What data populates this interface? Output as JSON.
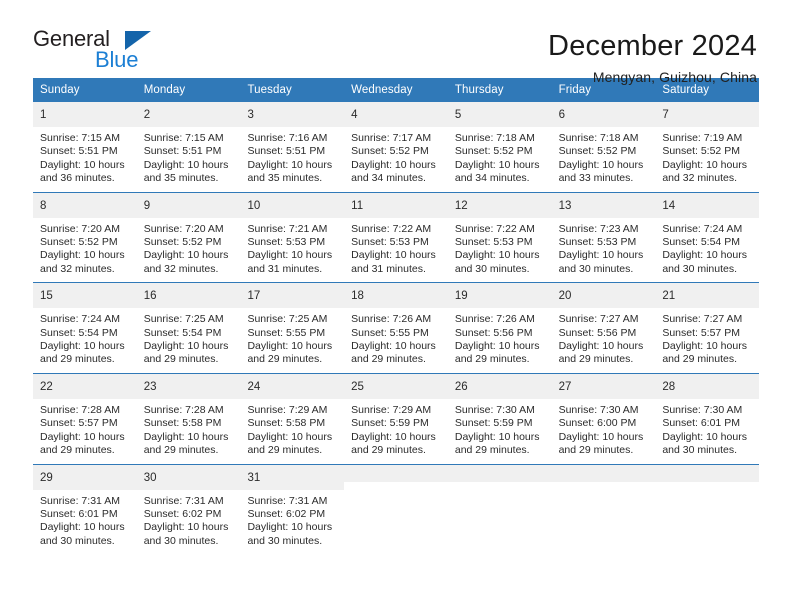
{
  "brand": {
    "name_part1": "General",
    "name_part2": "Blue",
    "triangle_icon": "triangle-icon",
    "color_dark": "#231f20",
    "color_blue": "#1c7fd4"
  },
  "header": {
    "title": "December 2024",
    "subtitle": "Mengyan, Guizhou, China"
  },
  "theme": {
    "header_bg": "#3079b8",
    "daynum_bg": "#f0f0f0",
    "text": "#2b2b2b"
  },
  "calendar": {
    "day_names": [
      "Sunday",
      "Monday",
      "Tuesday",
      "Wednesday",
      "Thursday",
      "Friday",
      "Saturday"
    ],
    "weeks": [
      [
        {
          "day": "1",
          "sunrise": "Sunrise: 7:15 AM",
          "sunset": "Sunset: 5:51 PM",
          "daylight1": "Daylight: 10 hours",
          "daylight2": "and 36 minutes."
        },
        {
          "day": "2",
          "sunrise": "Sunrise: 7:15 AM",
          "sunset": "Sunset: 5:51 PM",
          "daylight1": "Daylight: 10 hours",
          "daylight2": "and 35 minutes."
        },
        {
          "day": "3",
          "sunrise": "Sunrise: 7:16 AM",
          "sunset": "Sunset: 5:51 PM",
          "daylight1": "Daylight: 10 hours",
          "daylight2": "and 35 minutes."
        },
        {
          "day": "4",
          "sunrise": "Sunrise: 7:17 AM",
          "sunset": "Sunset: 5:52 PM",
          "daylight1": "Daylight: 10 hours",
          "daylight2": "and 34 minutes."
        },
        {
          "day": "5",
          "sunrise": "Sunrise: 7:18 AM",
          "sunset": "Sunset: 5:52 PM",
          "daylight1": "Daylight: 10 hours",
          "daylight2": "and 34 minutes."
        },
        {
          "day": "6",
          "sunrise": "Sunrise: 7:18 AM",
          "sunset": "Sunset: 5:52 PM",
          "daylight1": "Daylight: 10 hours",
          "daylight2": "and 33 minutes."
        },
        {
          "day": "7",
          "sunrise": "Sunrise: 7:19 AM",
          "sunset": "Sunset: 5:52 PM",
          "daylight1": "Daylight: 10 hours",
          "daylight2": "and 32 minutes."
        }
      ],
      [
        {
          "day": "8",
          "sunrise": "Sunrise: 7:20 AM",
          "sunset": "Sunset: 5:52 PM",
          "daylight1": "Daylight: 10 hours",
          "daylight2": "and 32 minutes."
        },
        {
          "day": "9",
          "sunrise": "Sunrise: 7:20 AM",
          "sunset": "Sunset: 5:52 PM",
          "daylight1": "Daylight: 10 hours",
          "daylight2": "and 32 minutes."
        },
        {
          "day": "10",
          "sunrise": "Sunrise: 7:21 AM",
          "sunset": "Sunset: 5:53 PM",
          "daylight1": "Daylight: 10 hours",
          "daylight2": "and 31 minutes."
        },
        {
          "day": "11",
          "sunrise": "Sunrise: 7:22 AM",
          "sunset": "Sunset: 5:53 PM",
          "daylight1": "Daylight: 10 hours",
          "daylight2": "and 31 minutes."
        },
        {
          "day": "12",
          "sunrise": "Sunrise: 7:22 AM",
          "sunset": "Sunset: 5:53 PM",
          "daylight1": "Daylight: 10 hours",
          "daylight2": "and 30 minutes."
        },
        {
          "day": "13",
          "sunrise": "Sunrise: 7:23 AM",
          "sunset": "Sunset: 5:53 PM",
          "daylight1": "Daylight: 10 hours",
          "daylight2": "and 30 minutes."
        },
        {
          "day": "14",
          "sunrise": "Sunrise: 7:24 AM",
          "sunset": "Sunset: 5:54 PM",
          "daylight1": "Daylight: 10 hours",
          "daylight2": "and 30 minutes."
        }
      ],
      [
        {
          "day": "15",
          "sunrise": "Sunrise: 7:24 AM",
          "sunset": "Sunset: 5:54 PM",
          "daylight1": "Daylight: 10 hours",
          "daylight2": "and 29 minutes."
        },
        {
          "day": "16",
          "sunrise": "Sunrise: 7:25 AM",
          "sunset": "Sunset: 5:54 PM",
          "daylight1": "Daylight: 10 hours",
          "daylight2": "and 29 minutes."
        },
        {
          "day": "17",
          "sunrise": "Sunrise: 7:25 AM",
          "sunset": "Sunset: 5:55 PM",
          "daylight1": "Daylight: 10 hours",
          "daylight2": "and 29 minutes."
        },
        {
          "day": "18",
          "sunrise": "Sunrise: 7:26 AM",
          "sunset": "Sunset: 5:55 PM",
          "daylight1": "Daylight: 10 hours",
          "daylight2": "and 29 minutes."
        },
        {
          "day": "19",
          "sunrise": "Sunrise: 7:26 AM",
          "sunset": "Sunset: 5:56 PM",
          "daylight1": "Daylight: 10 hours",
          "daylight2": "and 29 minutes."
        },
        {
          "day": "20",
          "sunrise": "Sunrise: 7:27 AM",
          "sunset": "Sunset: 5:56 PM",
          "daylight1": "Daylight: 10 hours",
          "daylight2": "and 29 minutes."
        },
        {
          "day": "21",
          "sunrise": "Sunrise: 7:27 AM",
          "sunset": "Sunset: 5:57 PM",
          "daylight1": "Daylight: 10 hours",
          "daylight2": "and 29 minutes."
        }
      ],
      [
        {
          "day": "22",
          "sunrise": "Sunrise: 7:28 AM",
          "sunset": "Sunset: 5:57 PM",
          "daylight1": "Daylight: 10 hours",
          "daylight2": "and 29 minutes."
        },
        {
          "day": "23",
          "sunrise": "Sunrise: 7:28 AM",
          "sunset": "Sunset: 5:58 PM",
          "daylight1": "Daylight: 10 hours",
          "daylight2": "and 29 minutes."
        },
        {
          "day": "24",
          "sunrise": "Sunrise: 7:29 AM",
          "sunset": "Sunset: 5:58 PM",
          "daylight1": "Daylight: 10 hours",
          "daylight2": "and 29 minutes."
        },
        {
          "day": "25",
          "sunrise": "Sunrise: 7:29 AM",
          "sunset": "Sunset: 5:59 PM",
          "daylight1": "Daylight: 10 hours",
          "daylight2": "and 29 minutes."
        },
        {
          "day": "26",
          "sunrise": "Sunrise: 7:30 AM",
          "sunset": "Sunset: 5:59 PM",
          "daylight1": "Daylight: 10 hours",
          "daylight2": "and 29 minutes."
        },
        {
          "day": "27",
          "sunrise": "Sunrise: 7:30 AM",
          "sunset": "Sunset: 6:00 PM",
          "daylight1": "Daylight: 10 hours",
          "daylight2": "and 29 minutes."
        },
        {
          "day": "28",
          "sunrise": "Sunrise: 7:30 AM",
          "sunset": "Sunset: 6:01 PM",
          "daylight1": "Daylight: 10 hours",
          "daylight2": "and 30 minutes."
        }
      ],
      [
        {
          "day": "29",
          "sunrise": "Sunrise: 7:31 AM",
          "sunset": "Sunset: 6:01 PM",
          "daylight1": "Daylight: 10 hours",
          "daylight2": "and 30 minutes."
        },
        {
          "day": "30",
          "sunrise": "Sunrise: 7:31 AM",
          "sunset": "Sunset: 6:02 PM",
          "daylight1": "Daylight: 10 hours",
          "daylight2": "and 30 minutes."
        },
        {
          "day": "31",
          "sunrise": "Sunrise: 7:31 AM",
          "sunset": "Sunset: 6:02 PM",
          "daylight1": "Daylight: 10 hours",
          "daylight2": "and 30 minutes."
        },
        {
          "day": "",
          "sunrise": "",
          "sunset": "",
          "daylight1": "",
          "daylight2": ""
        },
        {
          "day": "",
          "sunrise": "",
          "sunset": "",
          "daylight1": "",
          "daylight2": ""
        },
        {
          "day": "",
          "sunrise": "",
          "sunset": "",
          "daylight1": "",
          "daylight2": ""
        },
        {
          "day": "",
          "sunrise": "",
          "sunset": "",
          "daylight1": "",
          "daylight2": ""
        }
      ]
    ]
  }
}
